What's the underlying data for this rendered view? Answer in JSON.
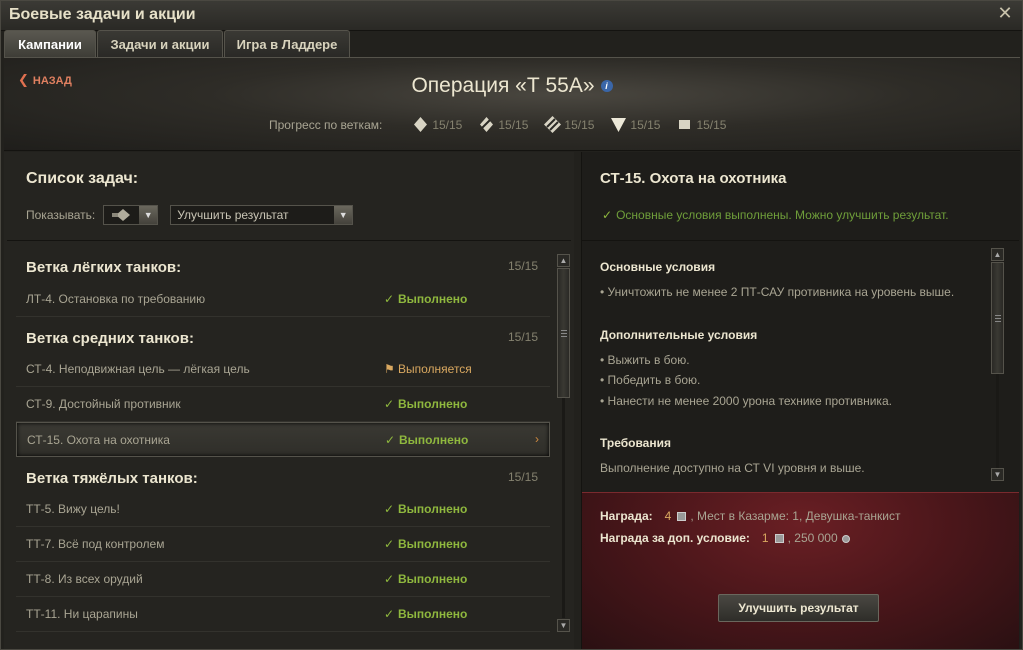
{
  "window": {
    "title": "Боевые задачи и акции",
    "close_icon": "✕"
  },
  "tabs": [
    {
      "label": "Кампании",
      "active": true
    },
    {
      "label": "Задачи и акции",
      "active": false
    },
    {
      "label": "Игра в Ладдере",
      "active": false
    }
  ],
  "header": {
    "back_label": "НАЗАД",
    "operation_title": "Операция «Т 55А»",
    "progress_label": "Прогресс по веткам:",
    "branches": [
      {
        "icon": "light-tank-icon",
        "value": "15/15"
      },
      {
        "icon": "medium-tank-icon",
        "value": "15/15"
      },
      {
        "icon": "heavy-tank-icon",
        "value": "15/15"
      },
      {
        "icon": "td-icon",
        "value": "15/15"
      },
      {
        "icon": "spg-icon",
        "value": "15/15"
      }
    ]
  },
  "tasks": {
    "title": "Список задач:",
    "show_label": "Показывать:",
    "filter_value": "Улучшить результат",
    "groups": [
      {
        "title": "Ветка лёгких танков:",
        "count": "15/15",
        "rows": [
          {
            "name": "ЛТ-4. Остановка по требованию",
            "status": "Выполнено",
            "state": "done"
          }
        ]
      },
      {
        "title": "Ветка средних танков:",
        "count": "15/15",
        "rows": [
          {
            "name": "СТ-4. Неподвижная цель — лёгкая цель",
            "status": "Выполняется",
            "state": "progress"
          },
          {
            "name": "СТ-9. Достойный противник",
            "status": "Выполнено",
            "state": "done"
          },
          {
            "name": "СТ-15. Охота на охотника",
            "status": "Выполнено",
            "state": "done",
            "selected": true
          }
        ]
      },
      {
        "title": "Ветка тяжёлых танков:",
        "count": "15/15",
        "rows": [
          {
            "name": "ТТ-5. Вижу цель!",
            "status": "Выполнено",
            "state": "done"
          },
          {
            "name": "ТТ-7. Всё под контролем",
            "status": "Выполнено",
            "state": "done"
          },
          {
            "name": "ТТ-8. Из всех орудий",
            "status": "Выполнено",
            "state": "done"
          },
          {
            "name": "ТТ-11. Ни царапины",
            "status": "Выполнено",
            "state": "done"
          }
        ]
      }
    ]
  },
  "details": {
    "title": "СТ-15. Охота на охотника",
    "status": "Основные условия выполнены. Можно улучшить результат.",
    "main_title": "Основные условия",
    "main_items": [
      "• Уничтожить не менее 2 ПТ-САУ противника на уровень выше."
    ],
    "extra_title": "Дополнительные условия",
    "extra_items": [
      "• Выжить в бою.",
      "• Победить в бою.",
      "• Нанести не менее 2000 урона технике противника."
    ],
    "req_title": "Требования",
    "req_text": "Выполнение доступно на СТ VI уровня и выше."
  },
  "reward": {
    "label": "Награда:",
    "amount": "4",
    "rest": ", Мест в Казарме: 1, Девушка-танкист",
    "extra_label": "Награда за доп. условие:",
    "extra_amount": "1",
    "extra_rest": ", 250 000",
    "button": "Улучшить результат"
  },
  "colors": {
    "done": "#8fb83e",
    "progress": "#d9a860",
    "reward_bg": "#5a1a1f"
  }
}
